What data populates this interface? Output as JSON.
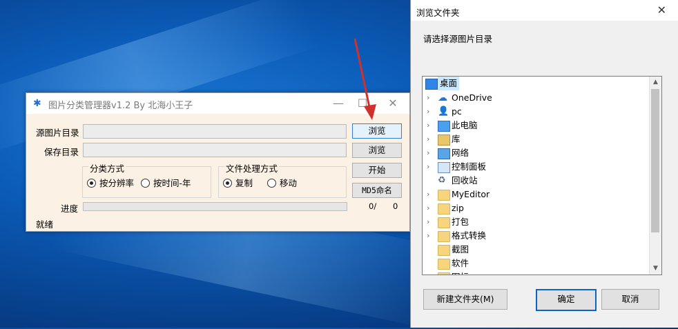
{
  "app": {
    "title": "图片分类管理器v1.2 By 北海小王子",
    "minimize": "—",
    "maximize": "☐",
    "close": "✕",
    "source_label": "源图片目录",
    "save_label": "保存目录",
    "source_value": "",
    "save_value": "",
    "browse1": "浏览",
    "browse2": "浏览",
    "start": "开始",
    "md5": "MD5命名",
    "classify_group": "分类方式",
    "radio_resolution": "按分辨率",
    "radio_time": "按时间-年",
    "file_group": "文件处理方式",
    "radio_copy": "复制",
    "radio_move": "移动",
    "progress_label": "进度",
    "progress_done": "0/",
    "progress_total": "0",
    "progress_fraction": 0,
    "status": "就绪"
  },
  "dialog": {
    "title": "浏览文件夹",
    "close": "✕",
    "prompt": "请选择源图片目录",
    "tree": [
      {
        "label": "桌面",
        "icon": "desktop-icon",
        "expandable": false
      },
      {
        "label": "OneDrive",
        "icon": "cloud-icon",
        "expandable": true
      },
      {
        "label": "pc",
        "icon": "user-icon",
        "expandable": true
      },
      {
        "label": "此电脑",
        "icon": "computer-icon",
        "expandable": true
      },
      {
        "label": "库",
        "icon": "library-icon",
        "expandable": true
      },
      {
        "label": "网络",
        "icon": "network-icon",
        "expandable": true
      },
      {
        "label": "控制面板",
        "icon": "control-panel-icon",
        "expandable": true
      },
      {
        "label": "回收站",
        "icon": "recycle-bin-icon",
        "expandable": false
      },
      {
        "label": "MyEditor",
        "icon": "folder-icon",
        "expandable": true
      },
      {
        "label": "zip",
        "icon": "folder-icon",
        "expandable": true
      },
      {
        "label": "打包",
        "icon": "folder-icon",
        "expandable": true
      },
      {
        "label": "格式转换",
        "icon": "folder-icon",
        "expandable": true
      },
      {
        "label": "截图",
        "icon": "folder-icon",
        "expandable": false
      },
      {
        "label": "软件",
        "icon": "folder-icon",
        "expandable": false
      },
      {
        "label": "图标",
        "icon": "folder-icon",
        "expandable": false
      }
    ],
    "new_folder": "新建文件夹(M)",
    "ok": "确定",
    "cancel": "取消"
  },
  "colors": {
    "accent": "#0a64c8",
    "arrow": "#d0312d",
    "selection": "#cce8ff"
  }
}
